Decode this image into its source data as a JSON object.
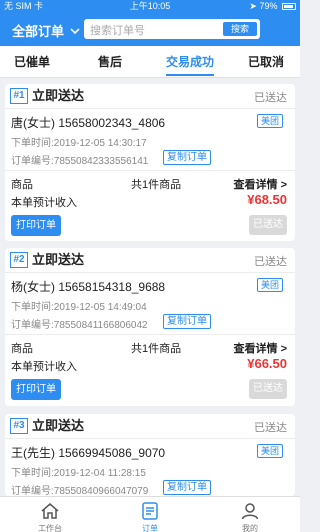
{
  "status_bar": {
    "carrier": "无 SIM 卡",
    "time": "上午10:05",
    "battery": "79%"
  },
  "header": {
    "filter_label": "全部订单",
    "search_placeholder": "搜索订单号",
    "search_button": "搜索"
  },
  "tabs": [
    {
      "label": "已催单"
    },
    {
      "label": "售后"
    },
    {
      "label": "交易成功"
    },
    {
      "label": "已取消"
    }
  ],
  "labels": {
    "goods": "商品",
    "view_details": "查看详情 >",
    "expected_income": "本单预计收入",
    "print_order": "打印订单",
    "copy_order": "复制订单",
    "delivered": "已送达"
  },
  "orders": [
    {
      "index": "#1",
      "title": "立即送达",
      "status": "已送达",
      "customer": "唐(女士) 15658002343_4806",
      "platform": "美团",
      "order_time": "下单时间:2019-12-05 14:30:17",
      "order_no": "订单编号:78550842333556141",
      "item_count": "共1件商品",
      "income": "¥68.50"
    },
    {
      "index": "#2",
      "title": "立即送达",
      "status": "已送达",
      "customer": "杨(女士) 15658154318_9688",
      "platform": "美团",
      "order_time": "下单时间:2019-12-05 14:49:04",
      "order_no": "订单编号:78550841166806042",
      "item_count": "共1件商品",
      "income": "¥66.50"
    },
    {
      "index": "#3",
      "title": "立即送达",
      "status": "已送达",
      "customer": "王(先生) 15669945086_9070",
      "platform": "美团",
      "order_time": "下单时间:2019-12-04 11:28:15",
      "order_no": "订单编号:78550840966047079"
    }
  ],
  "bottom_nav": [
    {
      "label": "工作台",
      "icon": "home-icon"
    },
    {
      "label": "订单",
      "icon": "order-list-icon",
      "active": true
    },
    {
      "label": "我的",
      "icon": "user-icon"
    }
  ],
  "colors": {
    "primary": "#2e8df0",
    "price": "#e33333",
    "disabled": "#d9d9d9"
  }
}
